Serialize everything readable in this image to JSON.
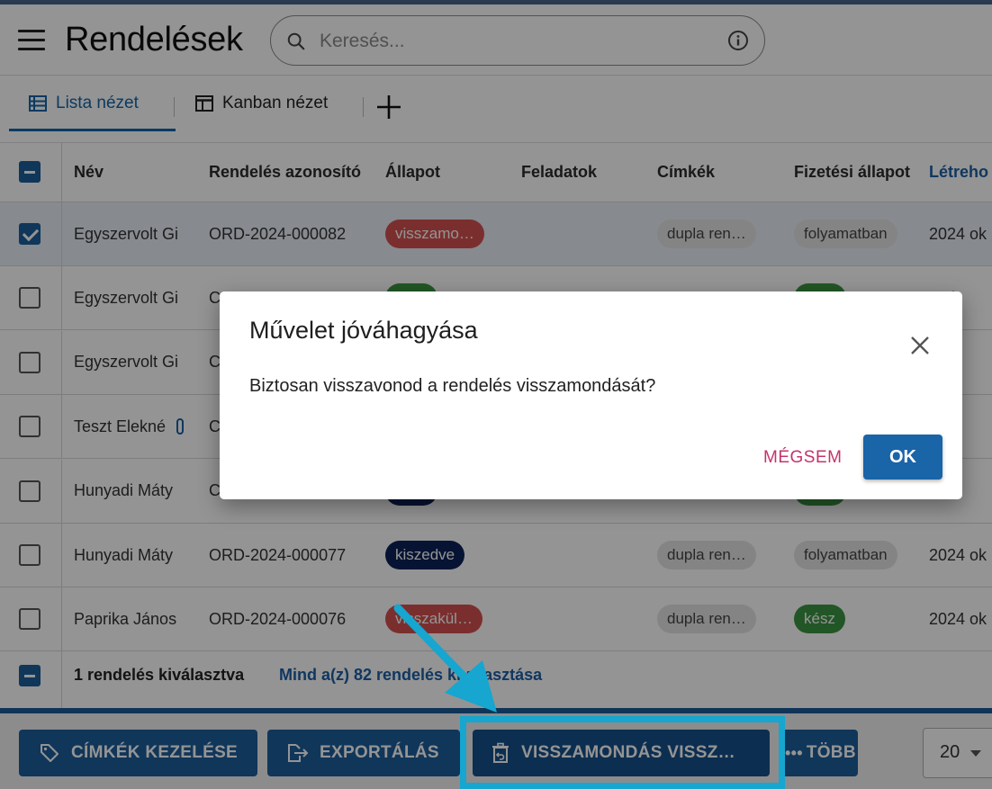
{
  "header": {
    "title": "Rendelések",
    "search_placeholder": "Keresés..."
  },
  "tabs": [
    {
      "label": "Lista nézet",
      "active": true
    },
    {
      "label": "Kanban nézet",
      "active": false
    }
  ],
  "table": {
    "columns": [
      "Név",
      "Rendelés azonosító",
      "Állapot",
      "Feladatok",
      "Címkék",
      "Fizetési állapot",
      "Létreho"
    ],
    "rows": [
      {
        "name": "Egyszervolt Gi",
        "id": "ORD-2024-000082",
        "status": "visszamo…",
        "status_color": "red",
        "tag": "dupla ren…",
        "payment": "folyamatban",
        "payment_color": "grey",
        "created": "2024 ok",
        "checked": true
      },
      {
        "name": "Egyszervolt Gi",
        "id": "C",
        "status": "",
        "status_color": "green",
        "tag": "",
        "payment": "",
        "payment_color": "green",
        "created": "4 ok",
        "checked": false
      },
      {
        "name": "Egyszervolt Gi",
        "id": "C",
        "status": "",
        "status_color": "",
        "tag": "",
        "payment": "",
        "payment_color": "",
        "created": "4 ok",
        "checked": false
      },
      {
        "name": "Teszt Elekné",
        "id": "C",
        "status": "",
        "status_color": "",
        "tag": "",
        "payment": "",
        "payment_color": "",
        "created": "4 ok",
        "checked": false
      },
      {
        "name": "Hunyadi Máty",
        "id": "C",
        "status": "",
        "status_color": "navy",
        "tag": "",
        "payment": "",
        "payment_color": "green",
        "created": "4 ok",
        "checked": false
      },
      {
        "name": "Hunyadi Máty",
        "id": "ORD-2024-000077",
        "status": "kiszedve",
        "status_color": "navy",
        "tag": "dupla ren…",
        "payment": "folyamatban",
        "payment_color": "grey",
        "created": "2024 ok",
        "checked": false
      },
      {
        "name": "Paprika János",
        "id": "ORD-2024-000076",
        "status": "visszakül…",
        "status_color": "red",
        "tag": "dupla ren…",
        "payment": "kész",
        "payment_color": "green",
        "created": "2024 ok",
        "checked": false
      }
    ]
  },
  "selection": {
    "text": "1 rendelés kiválasztva",
    "select_all": "Mind a(z) 82 rendelés kiválasztása"
  },
  "actions": {
    "labels": "CÍMKÉK KEZELÉSE",
    "export": "EXPORTÁLÁS",
    "revoke": "VISSZAMONDÁS VISSZ…",
    "more": "TÖBB",
    "page_size": "20"
  },
  "dialog": {
    "title": "Művelet jóváhagyása",
    "message": "Biztosan visszavonod a rendelés visszamondását?",
    "cancel": "MÉGSEM",
    "ok": "OK"
  },
  "colors": {
    "primary": "#1c5d9c",
    "chip_red": "#d35250",
    "chip_navy": "#0b2258",
    "chip_green": "#3b9442",
    "annotation": "#16a6cf",
    "cancel_text": "#c3346a"
  }
}
